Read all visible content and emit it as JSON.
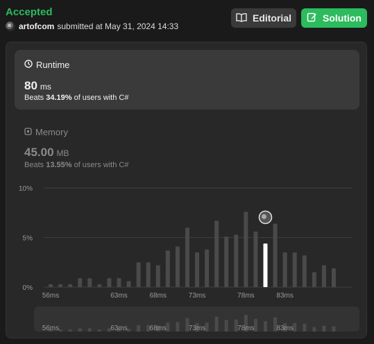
{
  "header": {
    "status": "Accepted",
    "username": "artofcom",
    "submitted_text": "submitted at May 31, 2024 14:33",
    "editorial_label": "Editorial",
    "solution_label": "Solution"
  },
  "runtime": {
    "title": "Runtime",
    "value": "80",
    "unit": "ms",
    "beats_label": "Beats",
    "beats_pct": "34.19%",
    "beats_suffix": "of users with C#"
  },
  "memory": {
    "title": "Memory",
    "value": "45.00",
    "unit": "MB",
    "beats_label": "Beats",
    "beats_pct": "13.55%",
    "beats_suffix": "of users with C#"
  },
  "colors": {
    "accent": "#2cbb5d",
    "bar": "#4a4a4a",
    "bar_highlight": "#ffffff"
  },
  "chart_data": {
    "type": "bar",
    "y_ticks": [
      "10%",
      "5%",
      "0%"
    ],
    "ylim": [
      0,
      10
    ],
    "x_tick_labels": [
      "56ms",
      "63ms",
      "68ms",
      "73ms",
      "78ms",
      "83ms"
    ],
    "values": [
      0.3,
      0.3,
      0.3,
      0.9,
      0.9,
      0.3,
      0.9,
      0.9,
      0.6,
      2.5,
      2.5,
      2.2,
      3.7,
      4.1,
      6.0,
      3.5,
      3.8,
      6.7,
      5.1,
      5.3,
      7.6,
      5.6,
      4.4,
      6.4,
      3.5,
      3.5,
      3.2,
      1.5,
      2.2,
      1.9
    ],
    "highlight_index": 22,
    "highlight_label": "80ms"
  }
}
